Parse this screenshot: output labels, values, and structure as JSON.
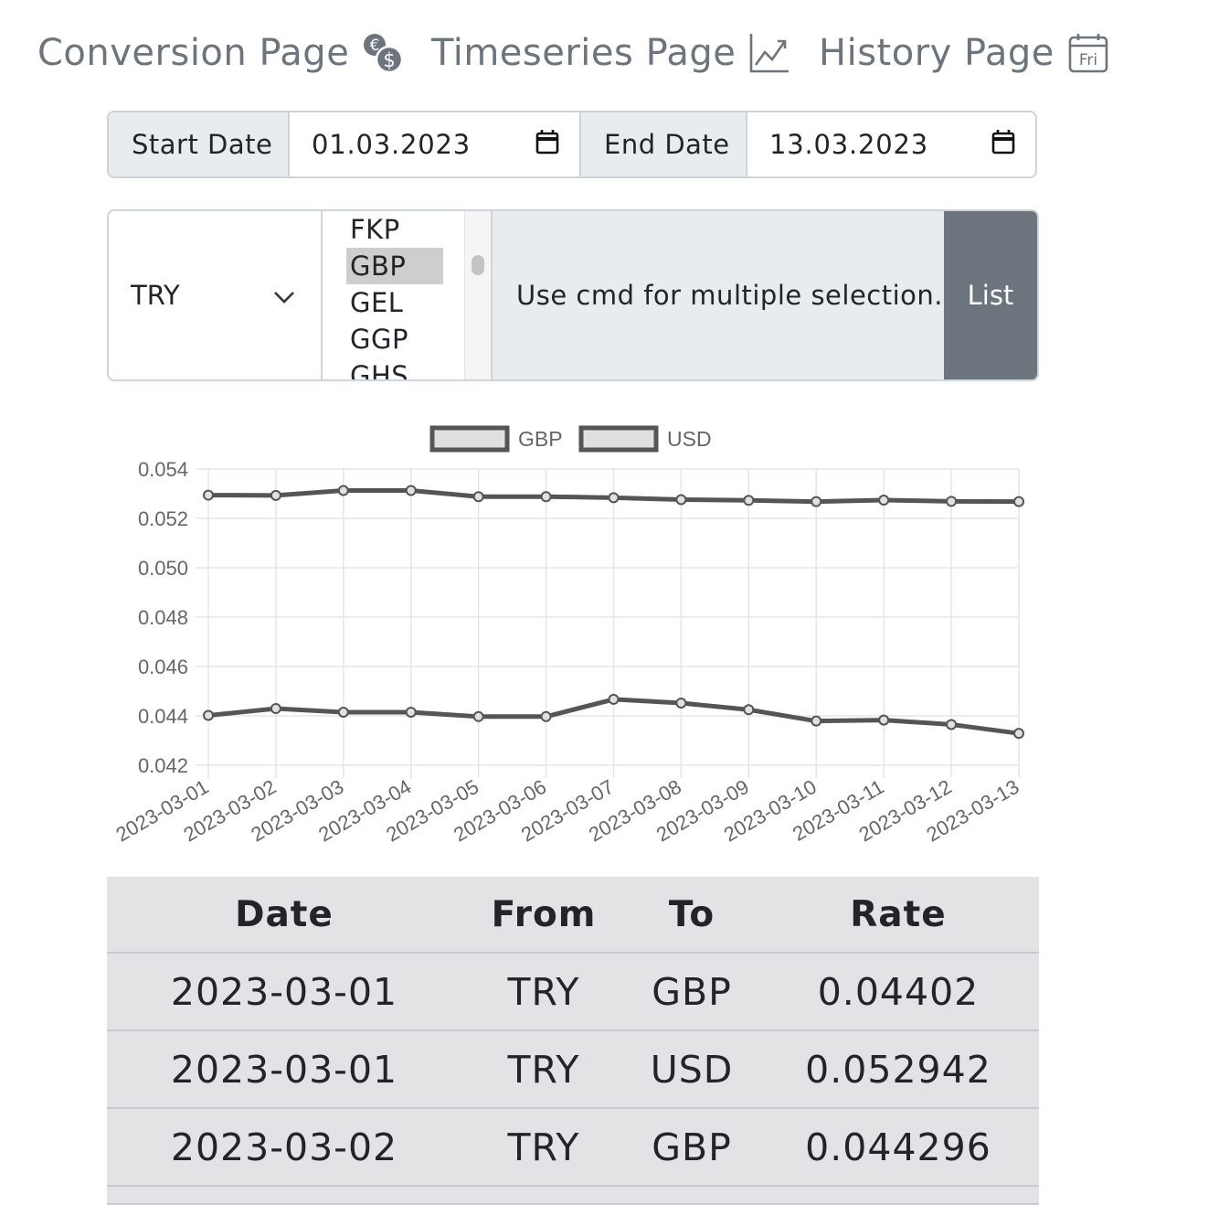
{
  "nav": [
    {
      "label": "Conversion Page",
      "icon": "currency-exchange-icon"
    },
    {
      "label": "Timeseries Page",
      "icon": "graph-up-icon"
    },
    {
      "label": "History Page",
      "icon": "calendar-week-icon",
      "icon_text": "Fri"
    }
  ],
  "dates": {
    "start_label": "Start Date",
    "start_value": "01.03.2023",
    "end_label": "End Date",
    "end_value": "13.03.2023"
  },
  "currency": {
    "base": "TRY",
    "options": [
      "FKP",
      "GBP",
      "GEL",
      "GGP",
      "GHS"
    ],
    "selected": "GBP",
    "hint": "Use cmd for multiple selection.",
    "list_button": "List"
  },
  "chart_data": {
    "type": "line",
    "categories": [
      "2023-03-01",
      "2023-03-02",
      "2023-03-03",
      "2023-03-04",
      "2023-03-05",
      "2023-03-06",
      "2023-03-07",
      "2023-03-08",
      "2023-03-09",
      "2023-03-10",
      "2023-03-11",
      "2023-03-12",
      "2023-03-13"
    ],
    "series": [
      {
        "name": "GBP",
        "values": [
          0.04402,
          0.044296,
          0.04415,
          0.04415,
          0.04397,
          0.04397,
          0.04467,
          0.04452,
          0.04425,
          0.04379,
          0.04383,
          0.04365,
          0.04329
        ]
      },
      {
        "name": "USD",
        "values": [
          0.052942,
          0.05293,
          0.05313,
          0.05313,
          0.05288,
          0.05288,
          0.05284,
          0.05276,
          0.05273,
          0.05268,
          0.05274,
          0.05269,
          0.05268
        ]
      }
    ],
    "yticks": [
      "0.054",
      "0.052",
      "0.050",
      "0.048",
      "0.046",
      "0.044",
      "0.042"
    ],
    "ylim": [
      0.042,
      0.054
    ],
    "grid": true,
    "legend": "top",
    "colors": {
      "line": "#555555",
      "legend_fill": "#e0e0e0",
      "grid": "#e5e5e5",
      "tick_text": "#666666"
    }
  },
  "table": {
    "headers": [
      "Date",
      "From",
      "To",
      "Rate"
    ],
    "rows": [
      [
        "2023-03-01",
        "TRY",
        "GBP",
        "0.04402"
      ],
      [
        "2023-03-01",
        "TRY",
        "USD",
        "0.052942"
      ],
      [
        "2023-03-02",
        "TRY",
        "GBP",
        "0.044296"
      ]
    ]
  }
}
